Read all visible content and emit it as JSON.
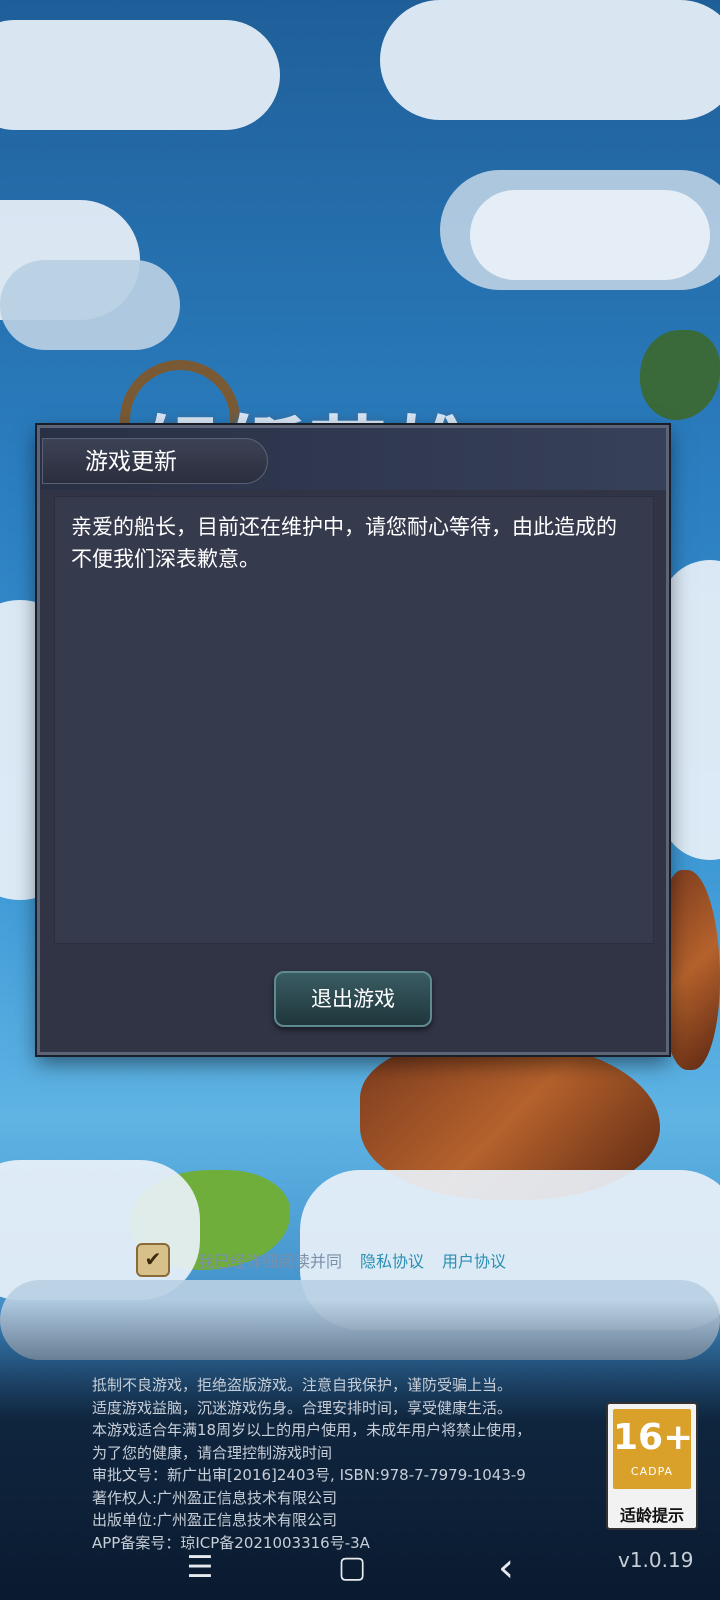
{
  "dialog": {
    "title": "游戏更新",
    "message": "亲爱的船长，目前还在维护中，请您耐心等待，由此造成的不便我们深表歉意。",
    "exit_button": "退出游戏"
  },
  "agreement": {
    "text": "我已经详细阅读并同",
    "privacy_link": "隐私协议",
    "user_link": "用户协议"
  },
  "footer": {
    "lines": [
      "抵制不良游戏，拒绝盗版游戏。注意自我保护，谨防受骗上当。",
      "适度游戏益脑，沉迷游戏伤身。合理安排时间，享受健康生活。",
      "本游戏适合年满18周岁以上的用户使用，未成年用户将禁止使用，",
      "为了您的健康，请合理控制游戏时间",
      "审批文号：新广出审[2016]2403号, ISBN:978-7-7979-1043-9",
      "著作权人:广州盈正信息技术有限公司",
      "出版单位:广州盈正信息技术有限公司",
      "APP备案号：琼ICP备2021003316号-3A"
    ]
  },
  "age_rating": {
    "number": "16+",
    "org": "CADPA",
    "caption": "适龄提示"
  },
  "version": "v1.0.19",
  "nav": {
    "menu_glyph": "☰",
    "home_glyph": "▢",
    "back_glyph": "‹"
  }
}
